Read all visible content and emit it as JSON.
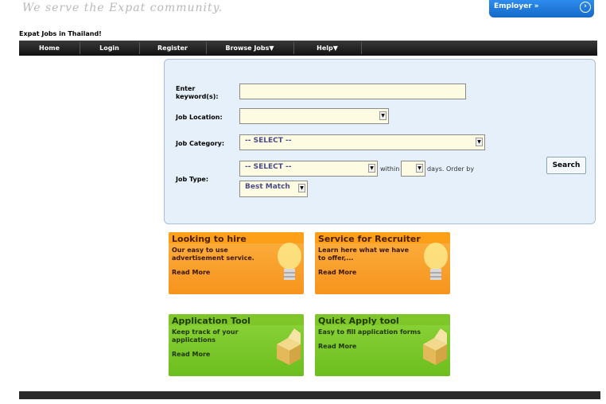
{
  "header": {
    "tagline": "We serve the Expat community.",
    "employer_button": "Employer »",
    "site_title": "Expat Jobs in Thailand!"
  },
  "nav": {
    "items": [
      {
        "label": "Home"
      },
      {
        "label": "Login"
      },
      {
        "label": "Register"
      },
      {
        "label": "Browse Jobs▼"
      },
      {
        "label": "Help▼"
      }
    ]
  },
  "search": {
    "keyword_label": "Enter keyword(s):",
    "keyword_value": "",
    "location_label": "Job Location:",
    "location_value": "",
    "category_label": "Job Category:",
    "category_value": "-- SELECT --",
    "type_label": "Job Type:",
    "type_value": "-- SELECT --",
    "within_label": "within",
    "days_value": "",
    "days_label": "days. Order by",
    "order_value": "Best Match",
    "search_button": "Search"
  },
  "cards": [
    {
      "title": "Looking to hire",
      "desc": "Our easy to use advertisement service.",
      "more": "Read More"
    },
    {
      "title": "Service for Recruiter",
      "desc": "Learn here what we have to offer,...",
      "more": "Read More"
    },
    {
      "title": "Application Tool",
      "desc": "Keep track of your applications",
      "more": "Read More"
    },
    {
      "title": "Quick Apply tool",
      "desc": "Easy to fill application forms",
      "more": "Read More"
    }
  ],
  "colors": {
    "accent_blue": "#1569c7",
    "orange": "#f7941d",
    "green": "#6cbe1e",
    "panel": "#e6f0fa"
  }
}
